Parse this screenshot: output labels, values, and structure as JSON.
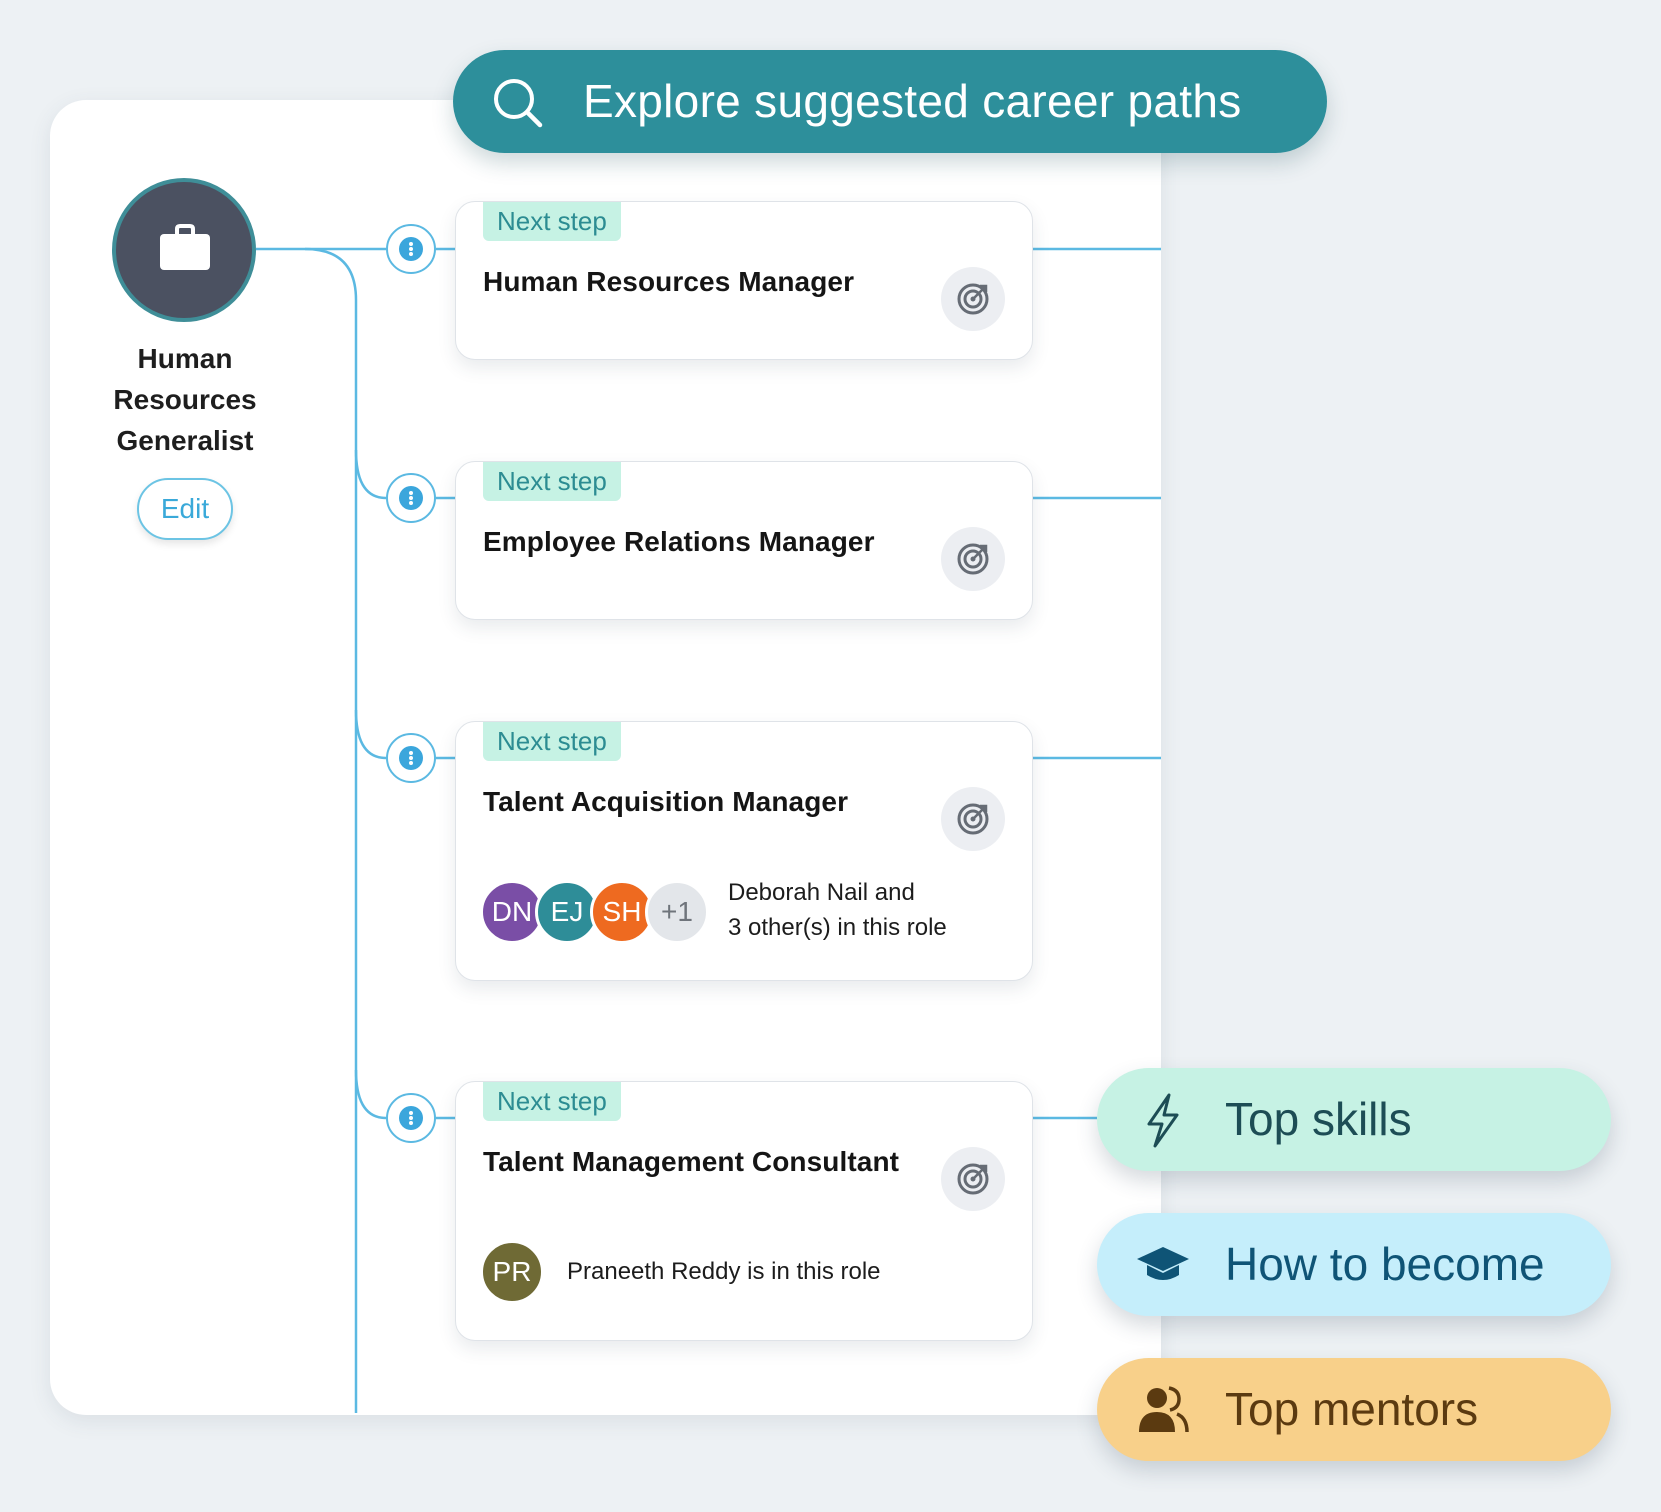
{
  "search": {
    "label": "Explore suggested career paths",
    "icon": "search-icon"
  },
  "current_role": {
    "name": "Human Resources Generalist",
    "icon": "briefcase-icon",
    "edit_label": "Edit"
  },
  "cards": [
    {
      "badge": "Next step",
      "title": "Human Resources Manager"
    },
    {
      "badge": "Next step",
      "title": "Employee Relations Manager"
    },
    {
      "badge": "Next step",
      "title": "Talent Acquisition Manager",
      "people": [
        {
          "initials": "DN",
          "color": "#7a4ea6"
        },
        {
          "initials": "EJ",
          "color": "#2e8d98"
        },
        {
          "initials": "SH",
          "color": "#ee6a20"
        },
        {
          "initials": "+1",
          "color": "#e3e6ea"
        }
      ],
      "people_line1": "Deborah Nail and",
      "people_line2": "3 other(s) in this role"
    },
    {
      "badge": "Next step",
      "title": "Talent Management Consultant",
      "people": [
        {
          "initials": "PR",
          "color": "#6f6a35"
        }
      ],
      "people_line1": "Praneeth Reddy is in this role"
    }
  ],
  "pills": [
    {
      "label": "Top skills",
      "icon": "lightning-icon",
      "bg": "#c6f2e4",
      "fg": "#1d4d55"
    },
    {
      "label": "How to become",
      "icon": "graduation-cap-icon",
      "bg": "#c5eefb",
      "fg": "#0f5476"
    },
    {
      "label": "Top mentors",
      "icon": "people-icon",
      "bg": "#f8d08a",
      "fg": "#5b3a10"
    }
  ],
  "colors": {
    "accent": "#2d8f9b",
    "line": "#5bb9e2",
    "badge_bg": "#c6f2e4",
    "badge_fg": "#2c8c92"
  }
}
